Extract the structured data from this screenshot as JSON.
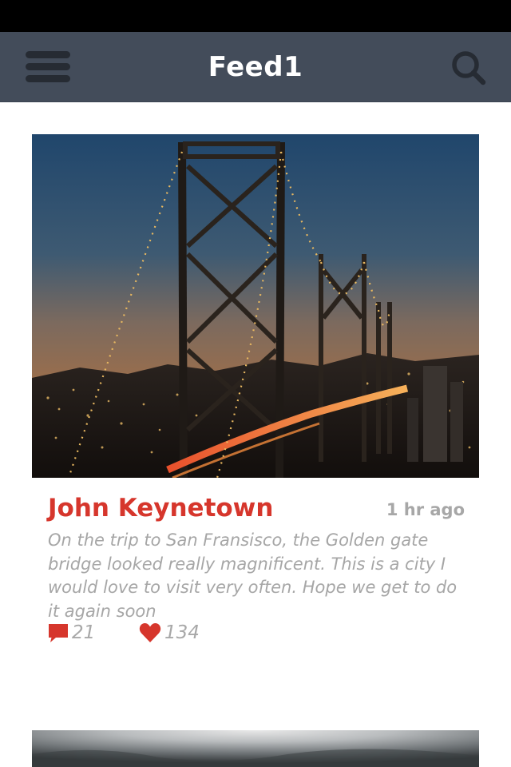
{
  "navbar": {
    "title": "Feed1",
    "menu_icon": "hamburger-menu-icon",
    "search_icon": "search-icon"
  },
  "post": {
    "author": "John Keynetown",
    "time": "1 hr ago",
    "caption": "On the trip to San Fransisco, the Golden gate bridge looked really magnificent. This is a city I would love to visit very often. Hope we get to do it again soon",
    "comments": {
      "icon": "comment-icon",
      "count": "21"
    },
    "likes": {
      "icon": "heart-icon",
      "count": "134"
    }
  },
  "colors": {
    "navbar": "#434c5a",
    "accent": "#d6362c",
    "muted_text": "#a6a6a6"
  }
}
